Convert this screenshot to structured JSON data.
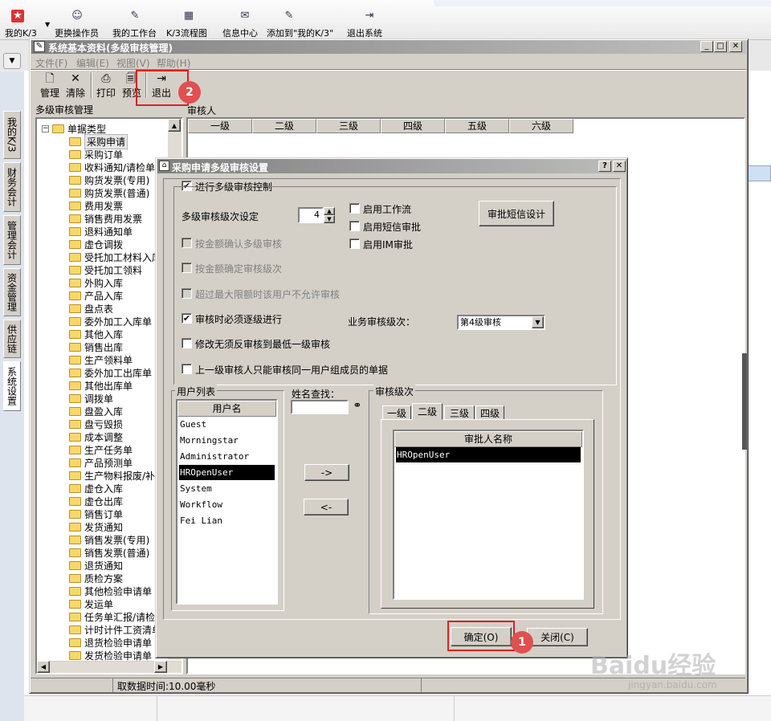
{
  "top_toolbar": {
    "items": [
      {
        "label": "我的K/3",
        "icon": "star-icon"
      },
      {
        "label": "更换操作员",
        "icon": "users-icon"
      },
      {
        "label": "我的工作台",
        "icon": "pencil-icon"
      },
      {
        "label": "K/3流程图",
        "icon": "flowchart-icon"
      },
      {
        "label": "信息中心",
        "icon": "chat-icon"
      },
      {
        "label": "添加到\"我的K/3\"",
        "icon": "add-favorite-icon"
      },
      {
        "label": "退出系统",
        "icon": "exit-icon"
      }
    ]
  },
  "side_tabs": [
    "我的K/3",
    "财务会计",
    "管理会计",
    "资金管理",
    "供应链",
    "系统设置"
  ],
  "main_window": {
    "title": "系统基本资料(多级审核管理)",
    "menu": [
      "文件(F)",
      "编辑(E)",
      "视图(V)",
      "帮助(H)"
    ],
    "toolbar": [
      "管理",
      "清除",
      "打印",
      "预览",
      "退出"
    ],
    "tree_header": "多级审核管理",
    "tree_root": "单据类型",
    "tree_items": [
      "采购申请",
      "采购订单",
      "收料通知/请检单",
      "购货发票(专用)",
      "购货发票(普通)",
      "费用发票",
      "销售费用发票",
      "退料通知单",
      "虚仓调拨",
      "受托加工材料入库",
      "受托加工领料",
      "外购入库",
      "产品入库",
      "盘点表",
      "委外加工入库单",
      "其他入库",
      "销售出库",
      "生产领料单",
      "委外加工出库单",
      "其他出库单",
      "调拨单",
      "盘盈入库",
      "盘亏毁损",
      "成本调整",
      "生产任务单",
      "产品预测单",
      "生产物料报废/补料单",
      "虚仓入库",
      "虚仓出库",
      "销售订单",
      "发货通知",
      "销售发票(专用)",
      "销售发票(普通)",
      "退货通知",
      "质检方案",
      "其他检验申请单",
      "发运单",
      "任务单汇报/请检单",
      "计时计件工资清单",
      "退货检验申请单",
      "发货检验申请单"
    ],
    "right_header": "审核人",
    "levels": [
      "一级",
      "二级",
      "三级",
      "四级",
      "五级",
      "六级"
    ],
    "status": "取数据时间:10.00毫秒"
  },
  "dialog": {
    "title": "采购申请多级审核设置",
    "enable_multi_audit": "进行多级审核控制",
    "level_setting_label": "多级审核级次设定",
    "level_value": "4",
    "enable_workflow": "启用工作流",
    "enable_sms_approval": "启用短信审批",
    "enable_im_approval": "启用IM审批",
    "sms_design_button": "审批短信设计",
    "amount_confirm": "按金额确认多级审核",
    "amount_level": "按金额确定审核级次",
    "over_limit": "超过最大限额时该用户不允许审核",
    "step_by_step": "审核时必须逐级进行",
    "business_level_label": "业务审核级次：",
    "business_level_value": "第4级审核",
    "modify_no_reverse": "修改无须反审核到最低一级审核",
    "same_group_only": "上一级审核人只能审核同一用户组成员的单据",
    "user_list_title": "用户列表",
    "user_col_header": "用户名",
    "users": [
      "Guest",
      "Morningstar",
      "Administrator",
      "HROpenUser",
      "System",
      "Workflow",
      "Fei Lian"
    ],
    "selected_user": "HROpenUser",
    "name_search_label": "姓名查找：",
    "add_button": "->",
    "remove_button": "<-",
    "audit_level_title": "审核级次",
    "tabs": [
      "一级",
      "二级",
      "三级",
      "四级"
    ],
    "active_tab": "二级",
    "approver_col_header": "审批人名称",
    "approvers": [
      "HROpenUser"
    ],
    "ok_button": "确定(O)",
    "close_button": "关闭(C)"
  },
  "annotations": [
    "1",
    "2"
  ],
  "watermark": {
    "brand": "Baidu经验",
    "url": "jingyan.baidu.com"
  }
}
